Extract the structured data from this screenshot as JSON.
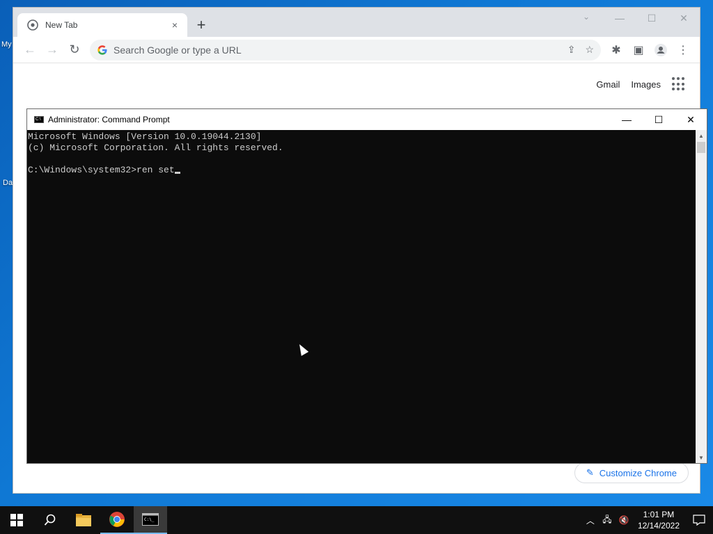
{
  "desktop": {
    "labels": [
      "My",
      "Da"
    ]
  },
  "chrome": {
    "tab_title": "New Tab",
    "tab_close": "×",
    "new_tab": "+",
    "omnibox_placeholder": "Search Google or type a URL",
    "links": {
      "gmail": "Gmail",
      "images": "Images"
    },
    "customize_label": "Customize Chrome"
  },
  "cmd": {
    "title": "Administrator: Command Prompt",
    "lines": [
      "Microsoft Windows [Version 10.0.19044.2130]",
      "(c) Microsoft Corporation. All rights reserved.",
      "",
      "C:\\Windows\\system32>ren set"
    ]
  },
  "taskbar": {
    "time": "1:01 PM",
    "date": "12/14/2022"
  }
}
